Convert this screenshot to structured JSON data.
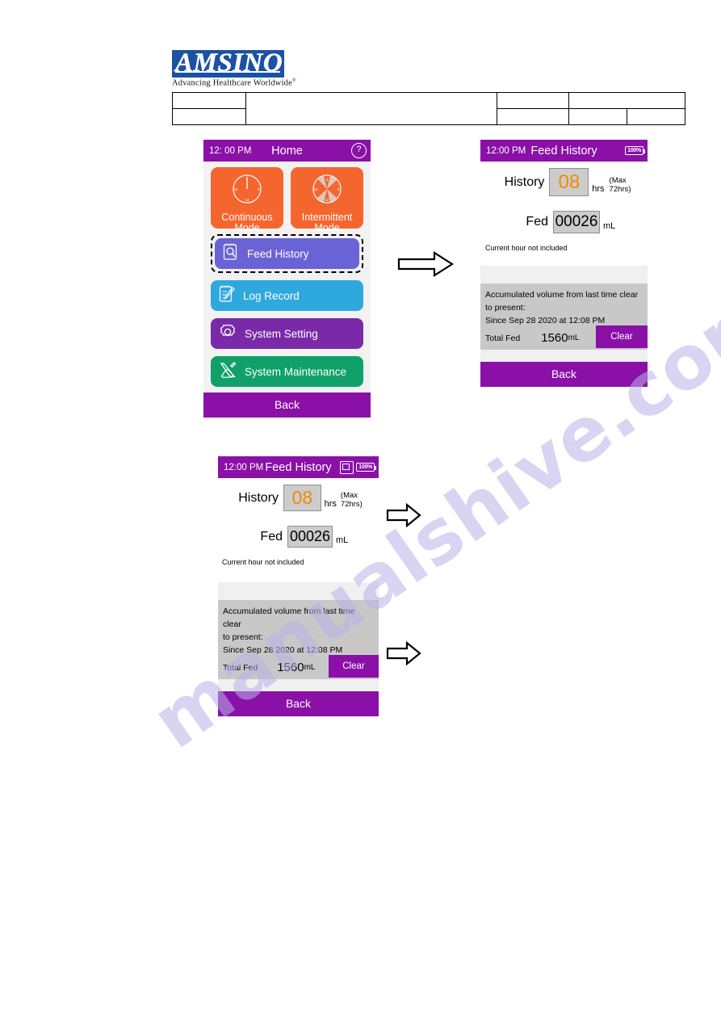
{
  "brand": {
    "name": "AMSINO",
    "tagline": "Advancing Healthcare Worldwide",
    "registered_mark": "®",
    "logo_bg": "#1b52a4"
  },
  "colors": {
    "purple": "#8a10a8",
    "orange": "#f5652e",
    "indigo": "#6a63d6",
    "blue": "#2fa8dd",
    "violet": "#7a2aa8",
    "green": "#10a06a",
    "field_grey": "#cccccc",
    "panel_grey": "#c8c8c8",
    "screen_grey": "#f2f2f2"
  },
  "watermark": {
    "text": "manualshive.com"
  },
  "header_table": {
    "rows": [
      [
        " ",
        " ",
        " ",
        " "
      ],
      [
        " ",
        " ",
        " ",
        " ",
        " "
      ]
    ]
  },
  "home_screen": {
    "name": "home-screen",
    "status_bar": {
      "time": "12: 00 PM",
      "title": "Home",
      "help_glyph": "?"
    },
    "modes": [
      {
        "id": "continuous",
        "label_line1": "Continuous",
        "label_line2": "Mode",
        "icon": "clock-icon"
      },
      {
        "id": "intermittent",
        "label_line1": "Intermittent",
        "label_line2": "Mode",
        "icon": "clock-segments-icon"
      }
    ],
    "menu": [
      {
        "id": "feed-history",
        "label": "Feed History",
        "icon": "notepad-magnifier-icon",
        "color": "#6a63d6",
        "selected": true
      },
      {
        "id": "log-record",
        "label": "Log Record",
        "icon": "notepad-pen-icon",
        "color": "#2fa8dd",
        "selected": false
      },
      {
        "id": "system-setting",
        "label": "System Setting",
        "icon": "gear-icon",
        "color": "#7a2aa8",
        "selected": false
      },
      {
        "id": "system-maintenance",
        "label": "System Maintenance",
        "icon": "tools-icon",
        "color": "#10a06a",
        "selected": false
      }
    ],
    "back_label": "Back"
  },
  "feed_history_screen_top": {
    "name": "feed-history-screen-right",
    "status_bar": {
      "time": "12:00 PM",
      "title": "Feed History",
      "battery": "100%",
      "show_sd": false
    },
    "history": {
      "label": "History",
      "value": "08",
      "unit": "hrs",
      "max_note": "(Max 72hrs)"
    },
    "fed": {
      "label": "Fed",
      "value": "00026",
      "unit": "mL"
    },
    "note": "Current hour not included",
    "panel": {
      "line1": "Accumulated volume from last time clear",
      "line2": "to present:",
      "line3": "Since Sep 28 2020 at 12:08 PM",
      "total_label": "Total Fed",
      "total_value": "1560",
      "total_unit": "mL",
      "clear_label": "Clear"
    },
    "back_label": "Back"
  },
  "feed_history_screen_bottom": {
    "name": "feed-history-screen-lower",
    "status_bar": {
      "time": "12:00 PM",
      "title": "Feed History",
      "battery": "100%",
      "show_sd": true
    },
    "history": {
      "label": "History",
      "value": "08",
      "unit": "hrs",
      "max_note": "(Max 72hrs)"
    },
    "fed": {
      "label": "Fed",
      "value": "00026",
      "unit": "mL"
    },
    "note": "Current hour not included",
    "panel": {
      "line1": "Accumulated volume from last time clear",
      "line2": "to present:",
      "line3": "Since Sep 28 2020 at 12:08 PM",
      "total_label": "Total Fed",
      "total_value": "1560",
      "total_unit": "mL",
      "clear_label": "Clear"
    },
    "back_label": "Back"
  },
  "arrows": [
    {
      "id": "arrow-home-to-feed-history"
    },
    {
      "id": "arrow-feed-history-upper"
    },
    {
      "id": "arrow-feed-history-lower"
    }
  ]
}
